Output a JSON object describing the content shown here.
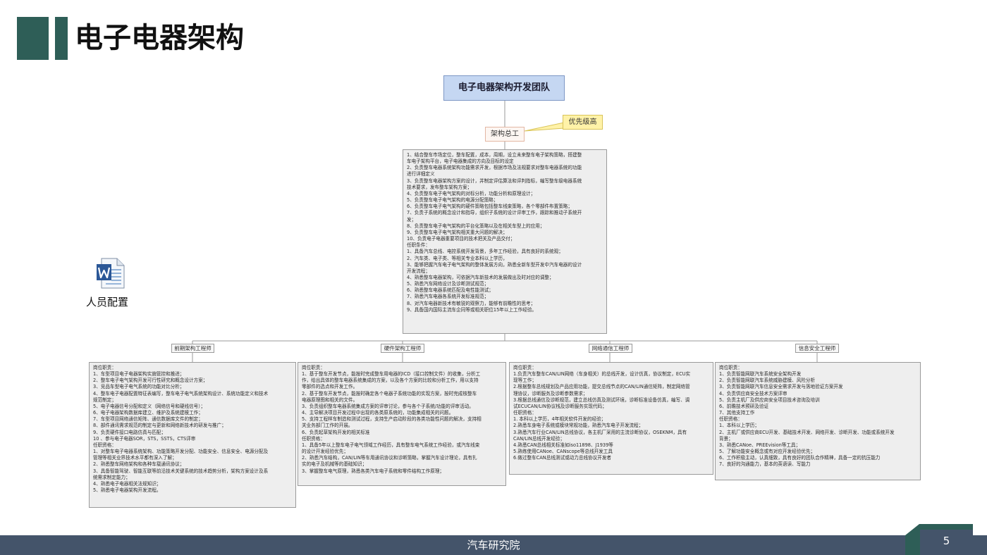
{
  "slide": {
    "title": "电子电器架构",
    "page_number": "5",
    "footer": "汽车研究院"
  },
  "colors": {
    "accent": "#2e5e57",
    "footer_bg": "#44546a",
    "root_fill": "#c5d7f2",
    "callout_fill": "#fff2a8",
    "note_fill": "#eeeeee"
  },
  "diagram": {
    "root": "电子电器架构开发团队",
    "chief": "架构总工",
    "callout": "优先级高",
    "chief_desc": [
      "1、结合整车市场定位，整车配置，成本，周期，设立未来整车电子架构策略，搭建整",
      "车电子架构平台，电子电器集成的方向及目标的设定",
      "2、负责整车电器系统架构功能需求开发，根据市场及法规要求对整车电器系统的功能",
      "进行详细定义",
      "3、负责整车电器架构方案的设计，并制定评估算法和评判指标，编写整车级电器系统",
      "技术要求，发布整车架构方案；",
      "4、负责整车电子电气架构的对标分析，功能分析和原理设计；",
      "5、负责整车电子电气架构的电源分配策略；",
      "6、负责整车电子电气架构的硬件策略包括整车线束策略，各个零部件布置策略；",
      "7、负责子系统的概念设计和指导，组织子系统的设计评审工作，跟踪和推动子系统开",
      "发；",
      "8、负责整车电子电气架构的平台化策略以及在相关车型上的应用；",
      "9、负责整车电子电气架构相关重大问题的解决；",
      "10、负责电子电器重要项目的技术把关及产品交付；",
      "任职条件：",
      "1、具备汽车总线、电控系统开发背景，多年工作经验，具有良好的系统观；",
      "2、汽车类、电子类、等相关专业本科以上学历，",
      "3、能够把握汽车电子电气架构的整体发展方向，熟悉全新车型开发中汽车电器的设计",
      "开发流程；",
      "4、熟悉整车电器架构，可依据汽车新技术的发展做出及时对应的调整；",
      "5、熟悉汽车网络设计及诊断测试规范；",
      "6、熟悉整车电器系统匹配及电性能测试；",
      "7、熟悉汽车电器各系统开发标准规范；",
      "8、对汽车电器新技术有敏锐的观察力，能够有前瞻性的思考；",
      "9、具备国内国际主流车企同等或相关职位15年以上工作经验。"
    ],
    "branches": [
      {
        "label": "前期架构工程师",
        "desc": [
          "岗位职责：",
          "1、车型项目电子电器架构实施管控和推进；",
          "2、整车电子电气架构开发可行性研究和概念设计方案；",
          "3、竞品车型电子电气系统的功能对比分析；",
          "4、整车电子电器配置特征表编写，整车电子电气系统架构设计、系统功能定义和技术",
          "规范制定；",
          "5、电子电器信号分配和定义（网络信号和硬线信号）；",
          "6、电子电器架构数据库建立、维护及系统建模工作；",
          "7、车型项目网络通信矩阵、通信数据库文件的制定；",
          "8、部件通讯需求规范的制定与更新和网络新技术的研发与推广；",
          "9、负责硬件接口电路仿真与匹配；",
          "10 、参与电子电器SOR，STS，SSTS，CTS评审",
          "任职资格：",
          "1、对整车电子电器系统架构、功能策略开发分配、功能安全、信息安全、电源分配及",
          "管理等相关业界技术水平都有深入了解；",
          "2、熟悉整车网络架构和各种车载通讯协议；",
          "3、具备智能驾驶、智能互联等前沿技术关键系统的技术趋势分析，架构方案设计及系",
          "统需求制定能力；",
          "4、熟悉电子电器相关法规知识；",
          "5、熟悉电子电器架构开发流程。"
        ]
      },
      {
        "label": "硬件架构工程师",
        "desc": [
          "岗位职责：",
          "1、基于整车开发节点，能按时完成整车用电器的ICD（接口控制文件）的收集，分析工",
          "作，给出具体的整车电器系统集成的方案，以及各个方案的比较和分析工作，用以支持",
          "零部件的选点和开发工作。",
          "2、基于整车开发节点，能按时确定各个电器子系统功能的实现方案，按时完成核整车",
          "电器原理图和相关的文件。",
          "3、负责组织整车电器系统集成方案的评审讨论，参与各个子系统/功能的评审活动。",
          "4、主导解决项目开发过程中出现的各类原系统的，功能集成相关的问题。",
          "5、支持工程样车制造和测试过程，支持生产启动阶段的各类功能性问题的解决，支持相",
          "关业务部门工作的开展。",
          "6、负责起草架构开发的相关标准",
          "任职资格：",
          "1、具备5年以上整车电子电气领域工作经历，具有整车电气系统工作经验，或汽车线束",
          "的设计开发经验优先；",
          "2、熟悉汽车结构，CAN/LIN等车用通讯协议和诊断策略，掌握汽车设计理论，具有扎",
          "实的电子及机械等的基础知识；",
          "3、掌握整车电气原理，熟悉各类汽车电子系统和零件结构工作原理；"
        ]
      },
      {
        "label": "网络通信工程师",
        "desc": [
          "岗位职责：",
          "1.负责汽车整车CAN/LIN网络（车身相关）的总线开发，设计仿真，协议制定，ECU实",
          "现等工作；",
          "2.根据整车总线规划及产品应用功能，提交总线节点的CAN/LIN通信矩阵，制定网络管",
          "理协议，诊断服务及诊断参数需求；",
          "3.根据总线通信及诊断规范，建立总线仿真及测试环境，诊断标准设备仿真，编写、调",
          "试ECUCAN/LIN协议栈及诊断服务实现代码；",
          "任职资格：",
          "1. 本科以上学历，4年相关软件开发的经验；",
          "2.熟悉车身电子系统或模块常规功能，熟悉汽车电子开发流程；",
          "3.熟悉汽车行业CAN/LIN总线协议，各主机厂采用的主流诊断协议，OSEKNM，具有",
          "CAN/LIN总线开发经验；",
          "4.熟悉CAN总线相关标准如iso11898、J1939等",
          "5.熟练使用CANoe、CANscope等总线开发工具",
          "6.做过整车CAN总线测试或动力总线协议开发者"
        ]
      },
      {
        "label": "信息安全工程师",
        "desc": [
          "岗位职责：",
          "1、负责智能网联汽车系统安全架构开发",
          "2、负责智能网联汽车系统威胁建模、风险分析",
          "3、负责智能网联汽车信息安全需求开发与落地验证方案开发",
          "4、负责供应商安全技术方案评审",
          "5、负责主机厂及供应商安全项目技术咨询及培训",
          "6、前瞻技术预研及验证",
          "7、其他支持工作",
          "任职资格：",
          "1、本科以上学历；",
          "2、主机厂或供应商ECU开发、基础技术开发、网络开发、诊断开发、功能或系统开发",
          "背景；",
          "3、熟悉CANoe、PREEvision等工具；",
          "5、了解功能安全概念或有对应开发经验优先；",
          "6、工作积极主动，认真细致，具有良好的团队合作精神，具备一定的抗压能力",
          "7、良好的沟通能力，基本的英语读、写能力"
        ]
      }
    ]
  },
  "attachment": {
    "icon": "word-document-icon",
    "label": "人员配置"
  }
}
